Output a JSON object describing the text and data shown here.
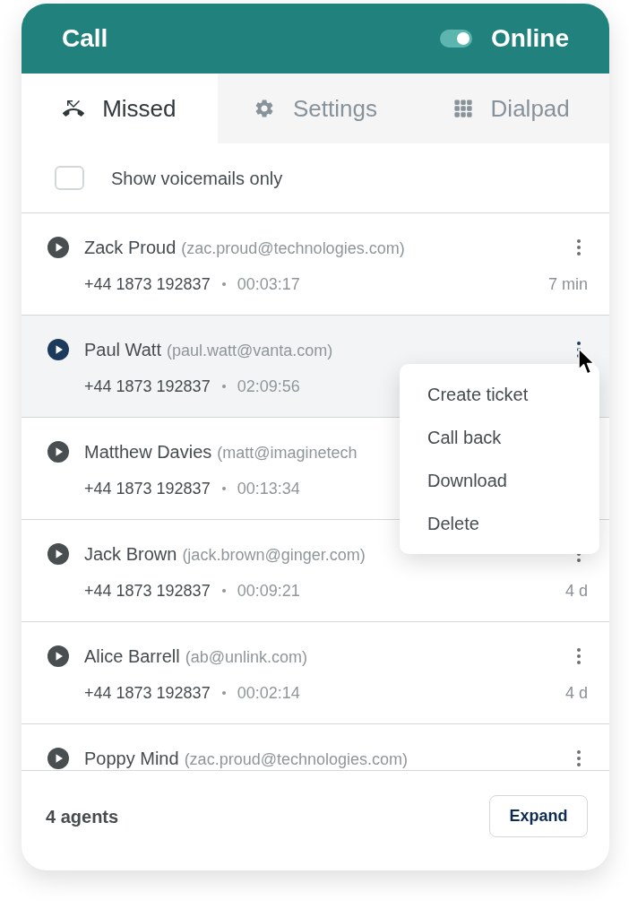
{
  "header": {
    "title": "Call",
    "online": true,
    "status_label": "Online"
  },
  "tabs": [
    {
      "label": "Missed",
      "kind": "missed",
      "selected": true
    },
    {
      "label": "Settings",
      "kind": "settings",
      "selected": false
    },
    {
      "label": "Dialpad",
      "kind": "dialpad",
      "selected": false
    }
  ],
  "filter": {
    "label": "Show voicemails only",
    "checked": false
  },
  "calls": [
    {
      "name": "Zack Proud",
      "email": "(zac.proud@technologies.com)",
      "phone": "+44 1873 192837",
      "duration": "00:03:17",
      "age": "7 min",
      "selected": false,
      "more_button": true
    },
    {
      "name": "Paul Watt",
      "email": "(paul.watt@vanta.com)",
      "phone": "+44 1873 192837",
      "duration": "02:09:56",
      "selected": true,
      "more_button": true
    },
    {
      "name": "Matthew Davies",
      "email": "(matt@imaginetech",
      "phone": "+44 1873 192837",
      "duration": "00:13:34",
      "selected": false,
      "more_button": false
    },
    {
      "name": "Jack Brown",
      "email": "(jack.brown@ginger.com)",
      "phone": "+44 1873 192837",
      "duration": "00:09:21",
      "age": "4 d",
      "selected": false,
      "more_button": true
    },
    {
      "name": "Alice Barrell",
      "email": "(ab@unlink.com)",
      "phone": "+44 1873 192837",
      "duration": "00:02:14",
      "age": "4 d",
      "selected": false,
      "more_button": true
    },
    {
      "name": "Poppy Mind",
      "email": "(zac.proud@technologies.com)",
      "selected": false,
      "more_button": true
    }
  ],
  "context_menu": {
    "items": [
      "Create ticket",
      "Call back",
      "Download",
      "Delete"
    ]
  },
  "footer": {
    "agents": "4 agents",
    "button": "Expand"
  }
}
